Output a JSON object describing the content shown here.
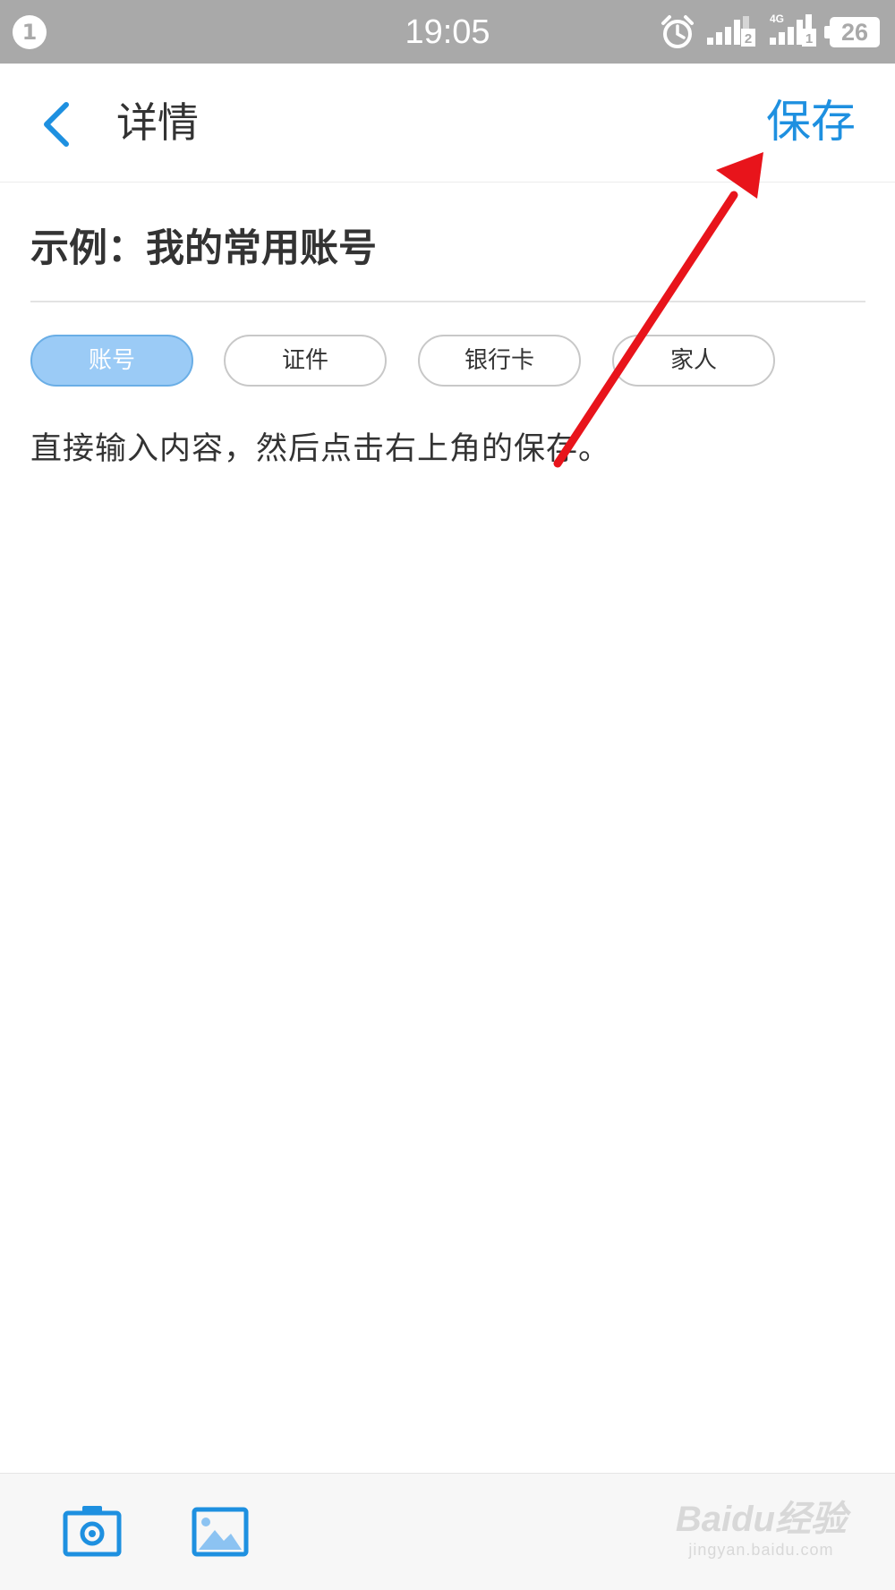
{
  "status_bar": {
    "notification_count": "1",
    "time": "19:05",
    "battery": "26",
    "network_label": "4G",
    "sim_1": "1",
    "sim_2": "2",
    "icons": [
      "alarm-icon",
      "signal-sim2-icon",
      "signal-4g-sim1-icon",
      "battery-icon"
    ]
  },
  "header": {
    "title": "详情",
    "save_label": "保存",
    "back_icon": "chevron-left-icon",
    "accent_color": "#1e90e0"
  },
  "record": {
    "title": "示例：我的常用账号"
  },
  "categories": [
    {
      "label": "账号",
      "active": true
    },
    {
      "label": "证件",
      "active": false
    },
    {
      "label": "银行卡",
      "active": false
    },
    {
      "label": "家人",
      "active": false
    }
  ],
  "content": {
    "hint": "直接输入内容，然后点击右上角的保存。"
  },
  "annotation": {
    "type": "arrow",
    "color": "#e8141b",
    "points_to": "save-button"
  },
  "bottom_bar": {
    "camera_icon": "camera-icon",
    "gallery_icon": "image-icon"
  },
  "watermark": {
    "logo": "Baidu经验",
    "url": "jingyan.baidu.com"
  }
}
